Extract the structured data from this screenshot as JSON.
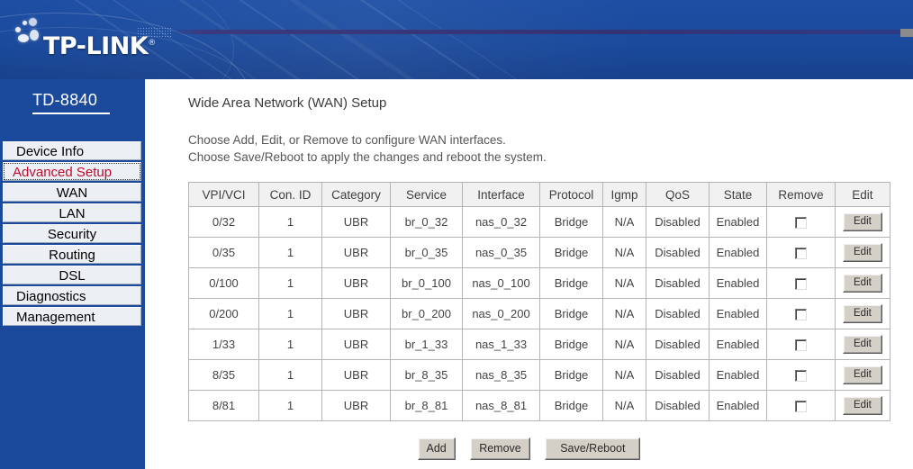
{
  "brand": {
    "logo_text": "TP-LINK",
    "logo_trademark": "®",
    "logo_mark_icon": "tp-link-dots-logo-icon",
    "model": "TD-8840"
  },
  "sidebar": {
    "items": [
      {
        "label": "Device Info",
        "level": "top",
        "active": false
      },
      {
        "label": "Advanced Setup",
        "level": "top",
        "active": true
      },
      {
        "label": "WAN",
        "level": "sub",
        "active": false
      },
      {
        "label": "LAN",
        "level": "sub",
        "active": false
      },
      {
        "label": "Security",
        "level": "sub",
        "active": false
      },
      {
        "label": "Routing",
        "level": "sub",
        "active": false
      },
      {
        "label": "DSL",
        "level": "sub",
        "active": false
      },
      {
        "label": "Diagnostics",
        "level": "top",
        "active": false
      },
      {
        "label": "Management",
        "level": "top",
        "active": false
      }
    ]
  },
  "main": {
    "title": "Wide Area Network (WAN) Setup",
    "intro_line1": "Choose Add, Edit, or Remove to configure WAN interfaces.",
    "intro_line2": "Choose Save/Reboot to apply the changes and reboot the system."
  },
  "table": {
    "headers": [
      "VPI/VCI",
      "Con. ID",
      "Category",
      "Service",
      "Interface",
      "Protocol",
      "Igmp",
      "QoS",
      "State",
      "Remove",
      "Edit"
    ],
    "edit_button_label": "Edit",
    "rows": [
      {
        "vpi_vci": "0/32",
        "con_id": "1",
        "category": "UBR",
        "service": "br_0_32",
        "interface": "nas_0_32",
        "protocol": "Bridge",
        "igmp": "N/A",
        "qos": "Disabled",
        "state": "Enabled",
        "remove_checked": false
      },
      {
        "vpi_vci": "0/35",
        "con_id": "1",
        "category": "UBR",
        "service": "br_0_35",
        "interface": "nas_0_35",
        "protocol": "Bridge",
        "igmp": "N/A",
        "qos": "Disabled",
        "state": "Enabled",
        "remove_checked": false
      },
      {
        "vpi_vci": "0/100",
        "con_id": "1",
        "category": "UBR",
        "service": "br_0_100",
        "interface": "nas_0_100",
        "protocol": "Bridge",
        "igmp": "N/A",
        "qos": "Disabled",
        "state": "Enabled",
        "remove_checked": false
      },
      {
        "vpi_vci": "0/200",
        "con_id": "1",
        "category": "UBR",
        "service": "br_0_200",
        "interface": "nas_0_200",
        "protocol": "Bridge",
        "igmp": "N/A",
        "qos": "Disabled",
        "state": "Enabled",
        "remove_checked": false
      },
      {
        "vpi_vci": "1/33",
        "con_id": "1",
        "category": "UBR",
        "service": "br_1_33",
        "interface": "nas_1_33",
        "protocol": "Bridge",
        "igmp": "N/A",
        "qos": "Disabled",
        "state": "Enabled",
        "remove_checked": false
      },
      {
        "vpi_vci": "8/35",
        "con_id": "1",
        "category": "UBR",
        "service": "br_8_35",
        "interface": "nas_8_35",
        "protocol": "Bridge",
        "igmp": "N/A",
        "qos": "Disabled",
        "state": "Enabled",
        "remove_checked": false
      },
      {
        "vpi_vci": "8/81",
        "con_id": "1",
        "category": "UBR",
        "service": "br_8_81",
        "interface": "nas_8_81",
        "protocol": "Bridge",
        "igmp": "N/A",
        "qos": "Disabled",
        "state": "Enabled",
        "remove_checked": false
      }
    ]
  },
  "actions": {
    "add_label": "Add",
    "remove_label": "Remove",
    "save_reboot_label": "Save/Reboot"
  },
  "colors": {
    "banner_blue": "#1b4a9c",
    "accent_red": "#c20a2e",
    "panel_white": "#ffffff",
    "table_header_gray": "#f1f1f1",
    "button_face": "#d4d0c8"
  }
}
